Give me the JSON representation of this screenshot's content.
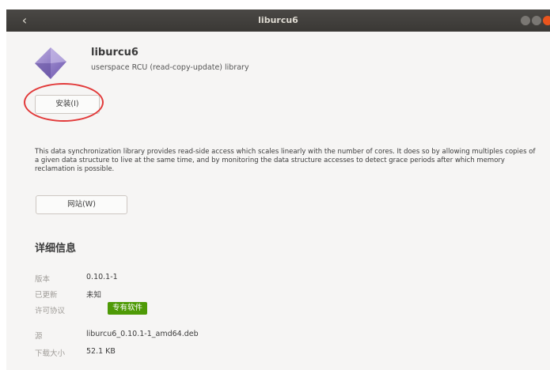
{
  "window": {
    "title": "liburcu6"
  },
  "app": {
    "name": "liburcu6",
    "summary": "userspace RCU (read-copy-update) library",
    "install_label": "安装(I)",
    "description": "This data synchronization library provides read-side access which scales linearly with the number of cores. It does so by allowing multiples copies of a given data structure to live at the same time, and by monitoring the data structure accesses to detect grace periods after which memory reclamation is possible.",
    "website_label": "网站(W)"
  },
  "details": {
    "heading": "详细信息",
    "version_label": "版本",
    "version_value": "0.10.1-1",
    "updated_label": "已更新",
    "updated_value": "未知",
    "license_label": "许可协议",
    "license_value": "专有软件",
    "source_label": "源",
    "source_value": "liburcu6_0.10.1-1_amd64.deb",
    "size_label": "下载大小",
    "size_value": "52.1 KB"
  },
  "colors": {
    "highlight": "#e23a3a",
    "license_badge": "#4e9a06",
    "titlebar": "#3c3b37",
    "close_button": "#e9541d"
  },
  "icons": {
    "back": "back-arrow-icon",
    "app": "package-diamond-icon"
  }
}
